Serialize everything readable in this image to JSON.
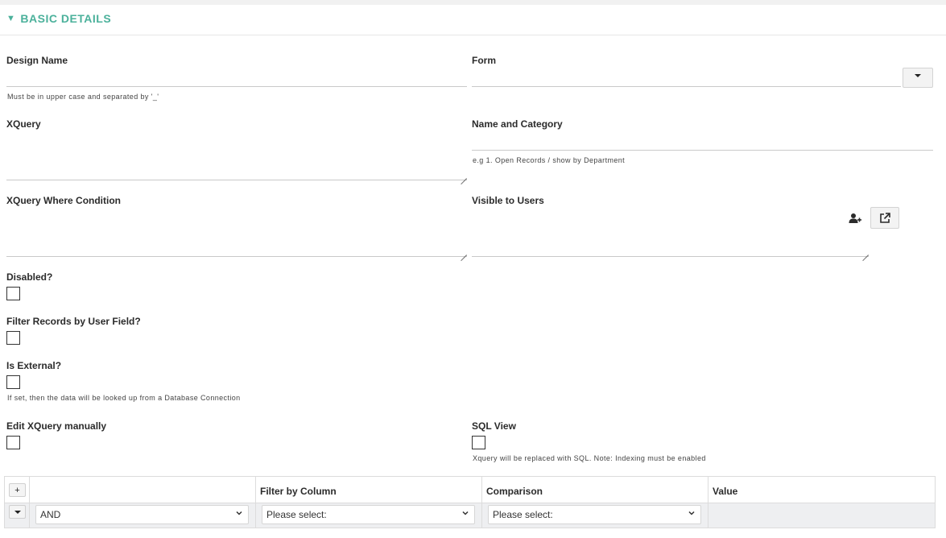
{
  "section": {
    "title": "BASIC DETAILS",
    "toggle_icon": "triangle-down-icon",
    "accent": "#4bb19b"
  },
  "fields": {
    "design_name": {
      "label": "Design Name",
      "value": "",
      "hint": "Must be in upper case and separated by '_'"
    },
    "form": {
      "label": "Form",
      "value": ""
    },
    "xquery": {
      "label": "XQuery",
      "value": ""
    },
    "name_category": {
      "label": "Name and Category",
      "value": "",
      "hint": "e.g 1. Open Records / show by Department"
    },
    "xquery_where": {
      "label": "XQuery Where Condition",
      "value": ""
    },
    "visible_users": {
      "label": "Visible to Users",
      "value": ""
    },
    "disabled": {
      "label": "Disabled?",
      "checked": false
    },
    "filter_records": {
      "label": "Filter Records by User Field?",
      "checked": false
    },
    "is_external": {
      "label": "Is External?",
      "checked": false,
      "hint": "If set, then the data will be looked up from a Database Connection"
    },
    "edit_manual": {
      "label": "Edit XQuery manually",
      "checked": false
    },
    "sql_view": {
      "label": "SQL View",
      "checked": false,
      "hint": "Xquery will be replaced with SQL. Note: Indexing must be enabled"
    }
  },
  "filter_table": {
    "add_label": "+",
    "headers": [
      "",
      "Filter by Column",
      "Comparison",
      "Value"
    ],
    "row": {
      "logic": "AND",
      "column": "Please select:",
      "comparison": "Please select:",
      "value": ""
    }
  }
}
